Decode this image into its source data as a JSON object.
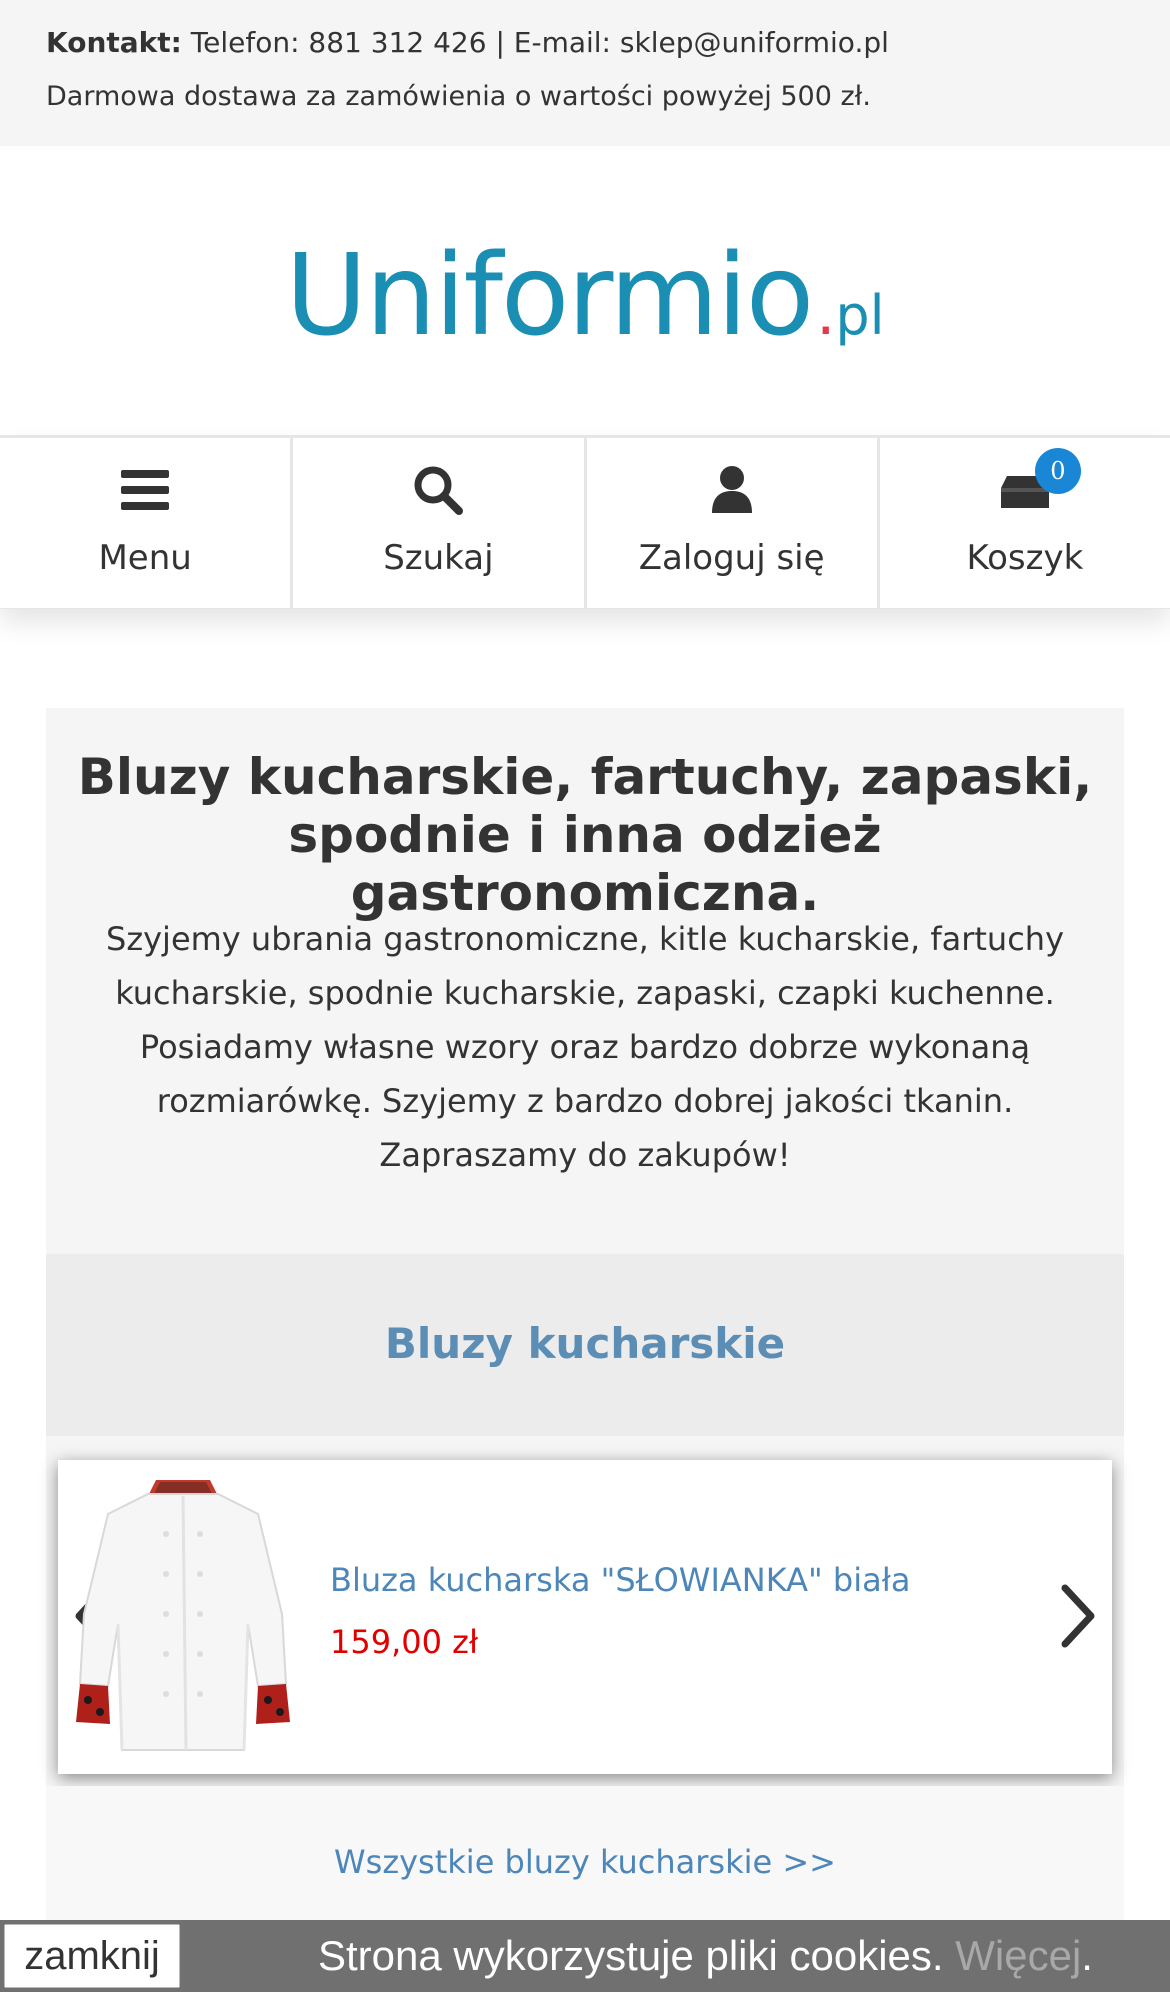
{
  "topbar": {
    "contact_label": "Kontakt:",
    "contact_text": " Telefon: 881 312 426 | E-mail: sklep@uniformio.pl",
    "shipping_text": "Darmowa dostawa za zamówienia o wartości powyżej 500 zł."
  },
  "logo": {
    "main": "Uniformio",
    "dot": ".",
    "tld": "pl"
  },
  "nav": {
    "items": [
      {
        "label": "Menu",
        "icon": "hamburger-icon"
      },
      {
        "label": "Szukaj",
        "icon": "search-icon"
      },
      {
        "label": "Zaloguj się",
        "icon": "user-icon"
      },
      {
        "label": "Koszyk",
        "icon": "cart-icon"
      }
    ],
    "cart_count": "0"
  },
  "hero": {
    "title": "Bluzy kucharskie, fartuchy, zapaski, spodnie i inna odzież gastronomiczna.",
    "text": "Szyjemy ubrania gastronomiczne, kitle kucharskie, fartuchy kucharskie, spodnie kucharskie, zapaski, czapki kuchenne. Posiadamy własne wzory oraz bardzo dobrze wykonaną rozmiarówkę. Szyjemy z bardzo dobrej jakości tkanin. Zapraszamy do zakupów!"
  },
  "section": {
    "title": "Bluzy kucharskie",
    "product": {
      "name": "Bluza kucharska \"SŁOWIANKA\" biała",
      "price": "159,00 zł"
    },
    "all_link": "Wszystkie bluzy kucharskie >>"
  },
  "cookie": {
    "close_label": "zamknij",
    "text": "Strona wykorzystuje pliki cookies. ",
    "more": "Więcej",
    "end": "."
  },
  "colors": {
    "brand": "#1a8fb3",
    "accent_dot": "#e63946",
    "link": "#4d86b8",
    "price": "#e00000",
    "badge": "#1a86d6"
  }
}
